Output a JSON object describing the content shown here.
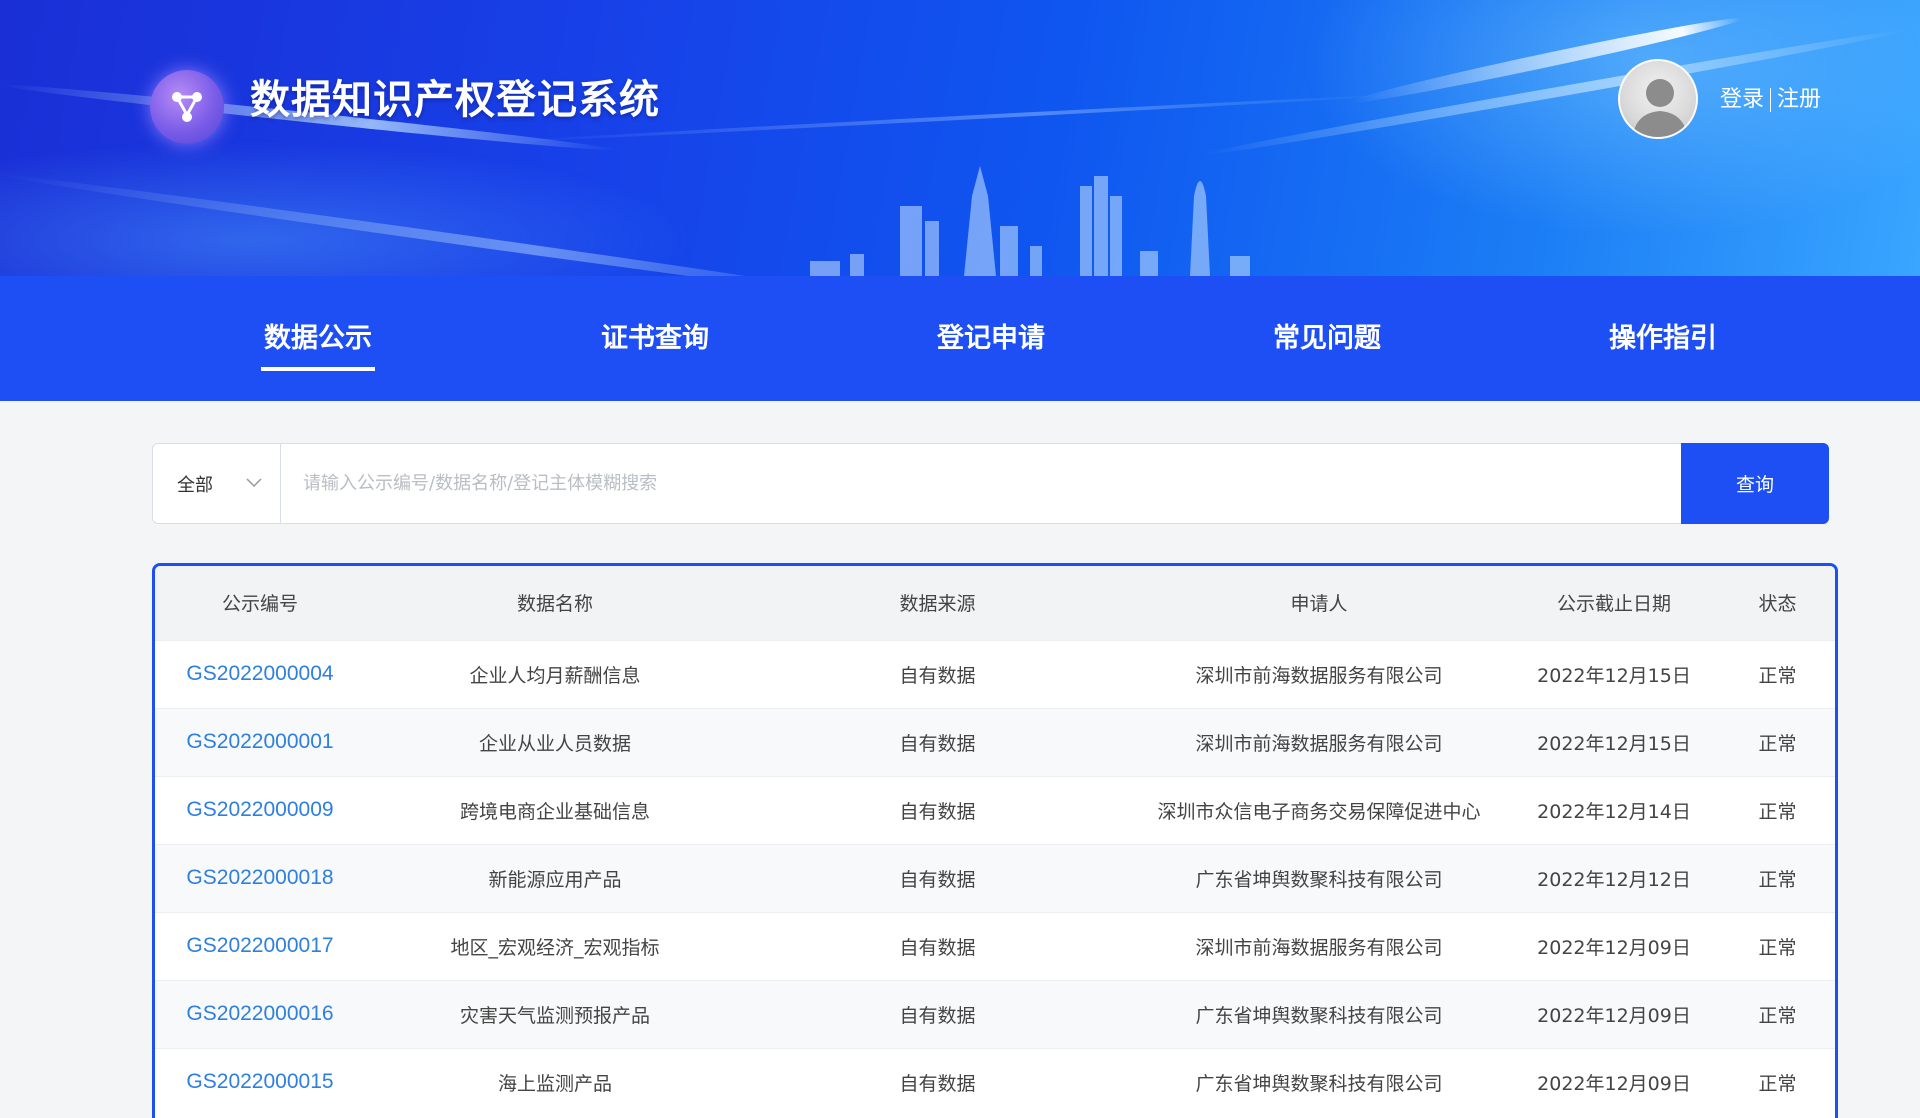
{
  "header": {
    "site_title": "数据知识产权登记系统",
    "login": "登录",
    "register": "注册",
    "logo_icon": "network-nodes-icon",
    "avatar_icon": "user-avatar-icon"
  },
  "nav": {
    "items": [
      {
        "label": "数据公示",
        "active": true
      },
      {
        "label": "证书查询",
        "active": false
      },
      {
        "label": "登记申请",
        "active": false
      },
      {
        "label": "常见问题",
        "active": false
      },
      {
        "label": "操作指引",
        "active": false
      }
    ]
  },
  "search": {
    "scope_value": "全部",
    "placeholder": "请输入公示编号/数据名称/登记主体模糊搜索",
    "value": "",
    "button": "查询"
  },
  "table": {
    "headers": [
      "公示编号",
      "数据名称",
      "数据来源",
      "申请人",
      "公示截止日期",
      "状态"
    ],
    "rows": [
      [
        "GS2022000004",
        "企业人均月薪酬信息",
        "自有数据",
        "深圳市前海数据服务有限公司",
        "2022年12月15日",
        "正常"
      ],
      [
        "GS2022000001",
        "企业从业人员数据",
        "自有数据",
        "深圳市前海数据服务有限公司",
        "2022年12月15日",
        "正常"
      ],
      [
        "GS2022000009",
        "跨境电商企业基础信息",
        "自有数据",
        "深圳市众信电子商务交易保障促进中心",
        "2022年12月14日",
        "正常"
      ],
      [
        "GS2022000018",
        "新能源应用产品",
        "自有数据",
        "广东省坤舆数聚科技有限公司",
        "2022年12月12日",
        "正常"
      ],
      [
        "GS2022000017",
        "地区_宏观经济_宏观指标",
        "自有数据",
        "深圳市前海数据服务有限公司",
        "2022年12月09日",
        "正常"
      ],
      [
        "GS2022000016",
        "灾害天气监测预报产品",
        "自有数据",
        "广东省坤舆数聚科技有限公司",
        "2022年12月09日",
        "正常"
      ],
      [
        "GS2022000015",
        "海上监测产品",
        "自有数据",
        "广东省坤舆数聚科技有限公司",
        "2022年12月09日",
        "正常"
      ]
    ]
  },
  "colors": {
    "primary": "#1e4ff5",
    "link": "#2d7fe0",
    "header_bg": "#f2f3f5"
  }
}
